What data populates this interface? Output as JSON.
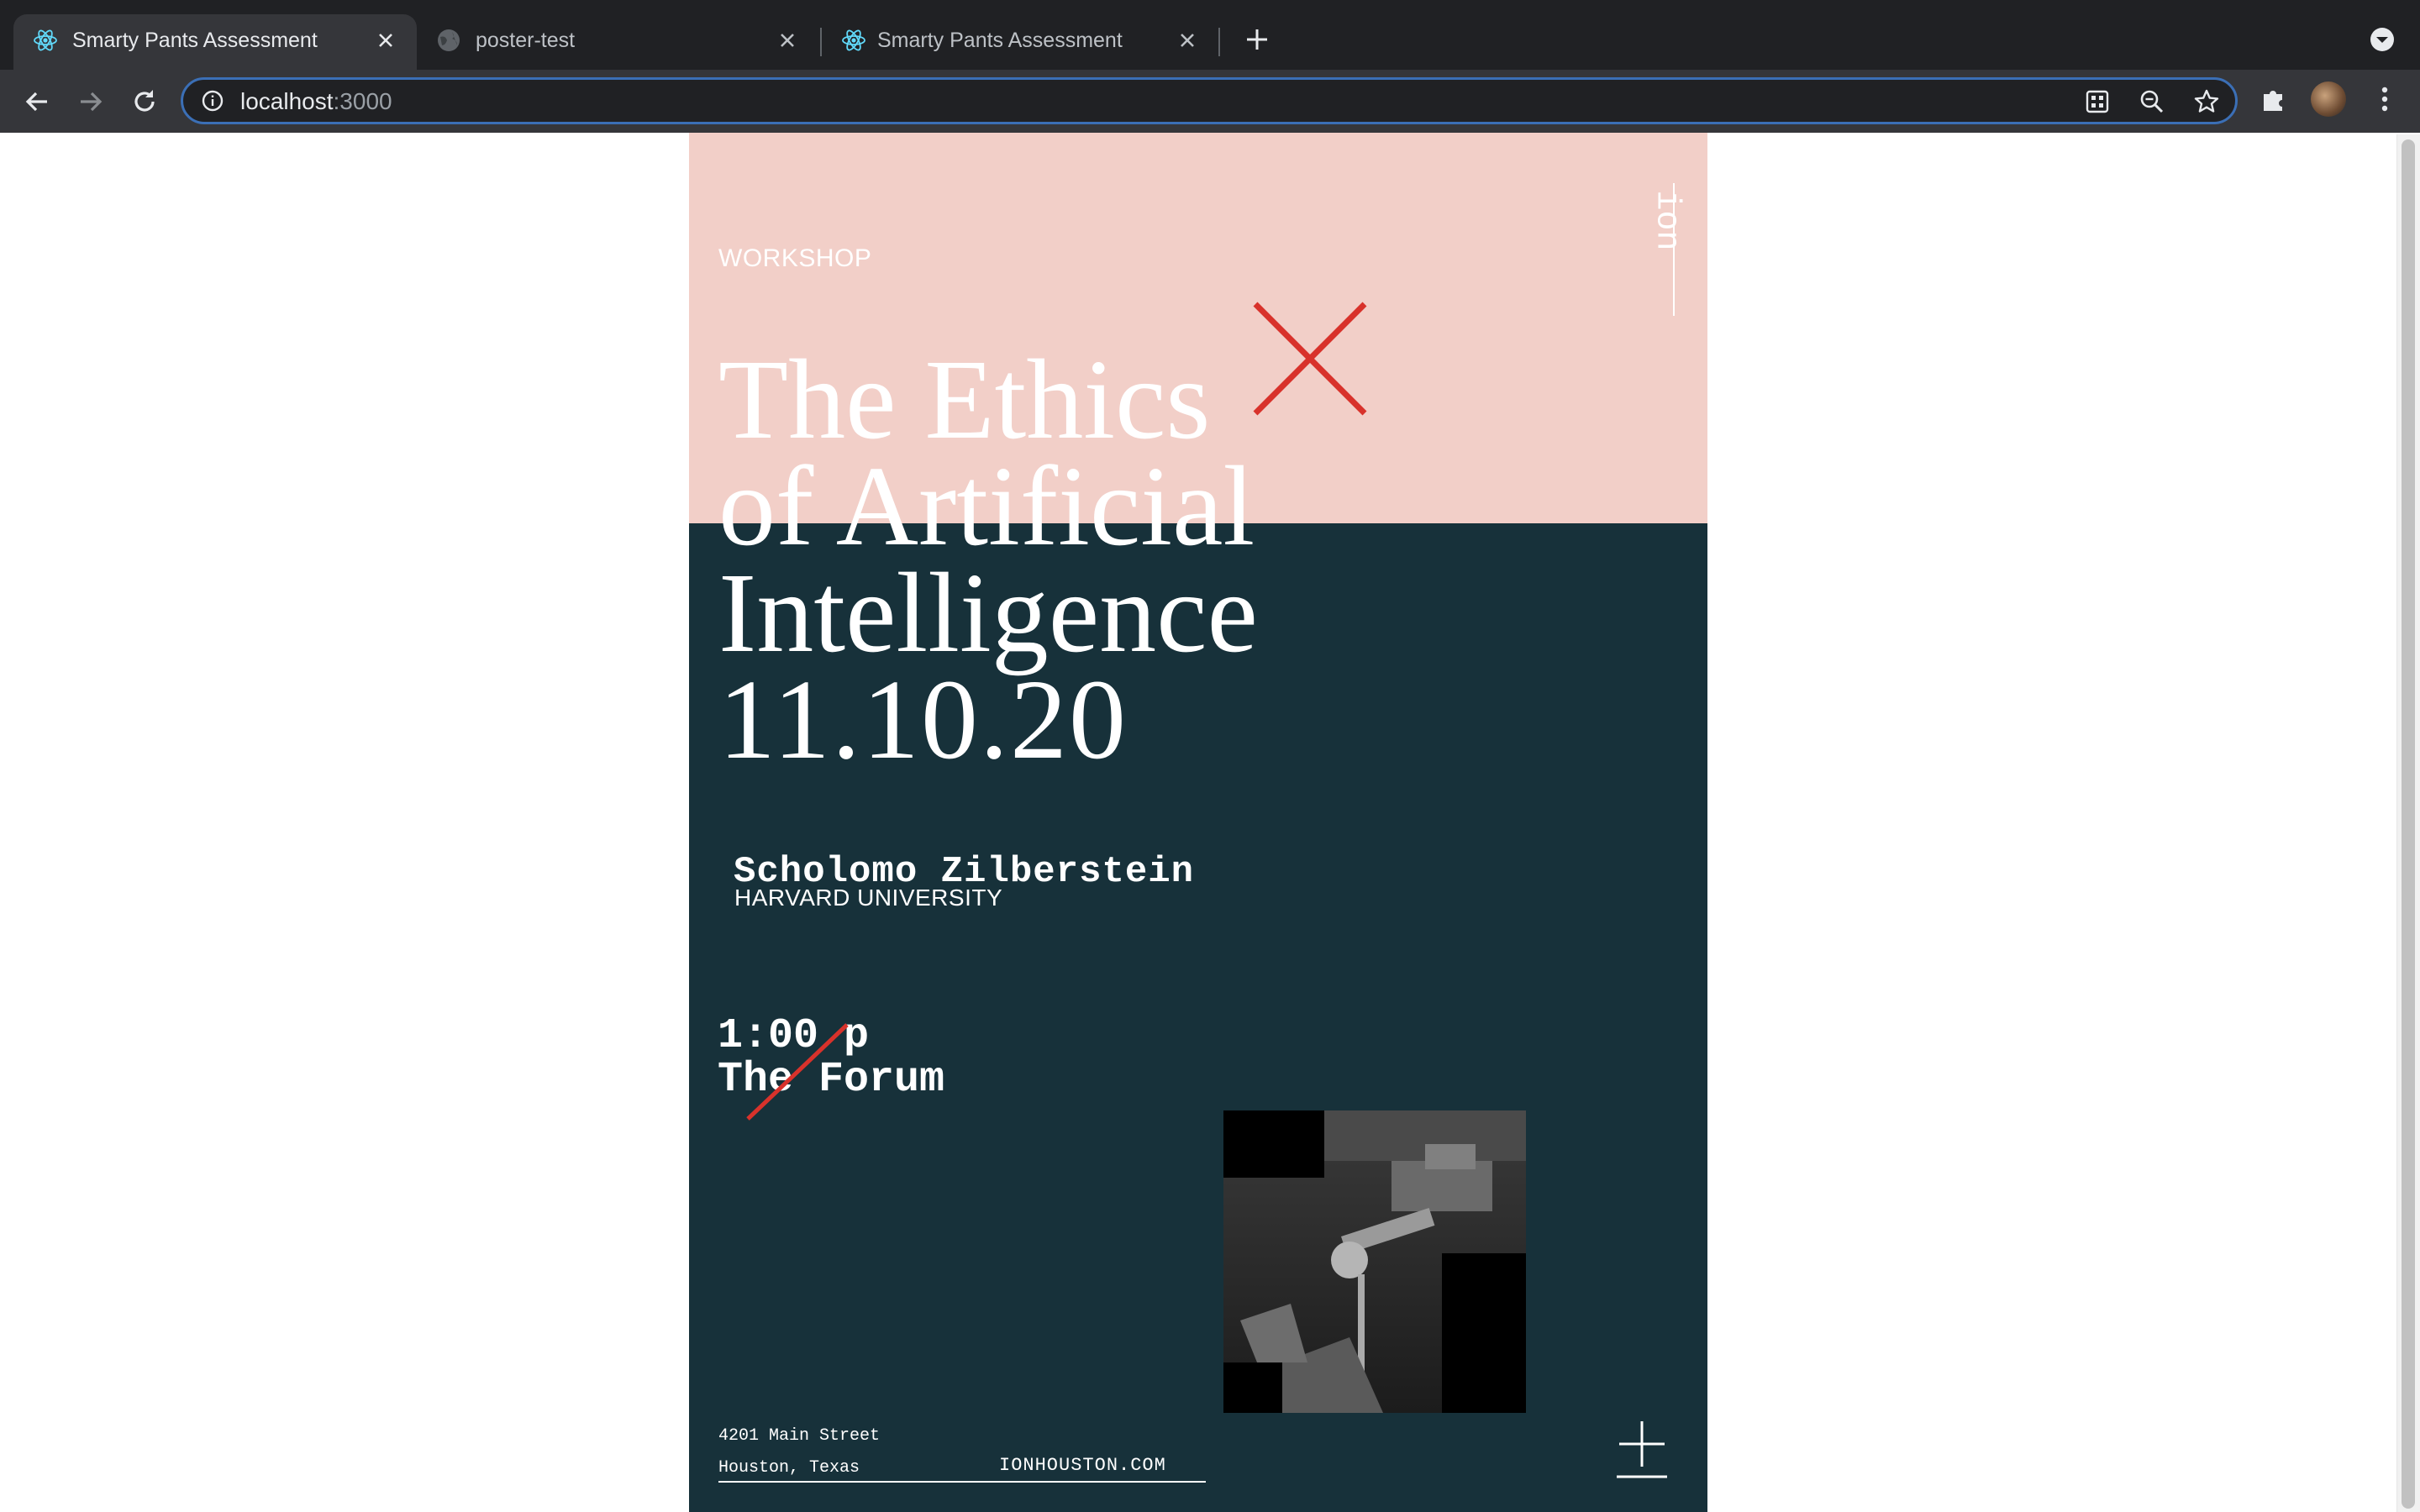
{
  "browser": {
    "tabs": [
      {
        "label": "Smarty Pants Assessment",
        "icon": "react-icon",
        "active": true
      },
      {
        "label": "poster-test",
        "icon": "globe-icon",
        "active": false
      },
      {
        "label": "Smarty Pants Assessment",
        "icon": "react-icon",
        "active": false
      }
    ],
    "url_host": "localhost",
    "url_port": ":3000"
  },
  "poster": {
    "category": "WORKSHOP",
    "logo": "ion",
    "title_lines": [
      "The Ethics",
      "of Artificial",
      "Intelligence"
    ],
    "date": "11.10.20",
    "speaker_name": "Scholomo Zilberstein",
    "speaker_affiliation": "HARVARD UNIVERSITY",
    "time": "1:00 p",
    "venue": "The Forum",
    "address_line1": "4201 Main Street",
    "address_line2": "Houston, Texas",
    "website": "IONHOUSTON.COM",
    "colors": {
      "pink": "#f2cfc8",
      "dark_teal": "#17313a",
      "accent_red": "#d8322b",
      "text": "#ffffff"
    }
  }
}
